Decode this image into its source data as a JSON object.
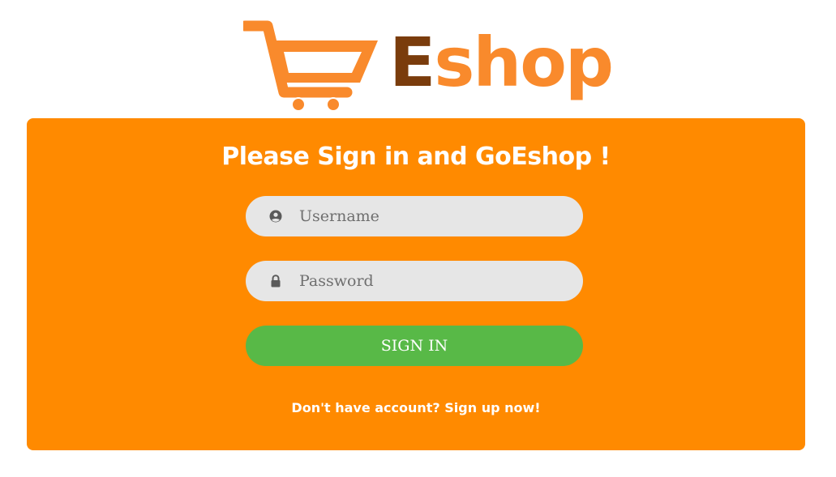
{
  "logo": {
    "text_first": "E",
    "text_rest": "shop",
    "colors": {
      "cart": "#f98a2c",
      "first_letter": "#7a3c0c",
      "rest": "#f98a2c"
    }
  },
  "form": {
    "title": "Please Sign in and GoEshop !",
    "username": {
      "placeholder": "Username",
      "value": "",
      "icon": "user-circle-icon"
    },
    "password": {
      "placeholder": "Password",
      "value": "",
      "icon": "lock-icon"
    },
    "submit_label": "SIGN IN",
    "signup_link": "Don't have account? Sign up now!"
  },
  "colors": {
    "panel": "#ff8a00",
    "input_bg": "#e6e6e6",
    "button": "#58b947",
    "text_light": "#ffffff"
  }
}
